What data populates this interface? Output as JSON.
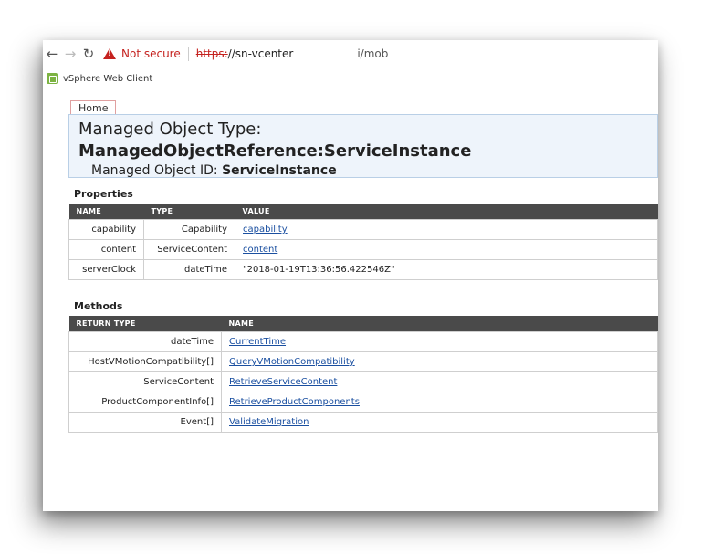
{
  "browser": {
    "security_text": "Not secure",
    "url_scheme": "https:",
    "url_host": "//sn-vcenter",
    "url_path": "i/mob",
    "bookmark": "vSphere Web Client"
  },
  "page": {
    "home_tab": "Home",
    "type_label": "Managed Object Type: ",
    "type_value": "ManagedObjectReference:ServiceInstance",
    "id_label": "Managed Object ID: ",
    "id_value": "ServiceInstance"
  },
  "properties": {
    "title": "Properties",
    "headers": [
      "NAME",
      "TYPE",
      "VALUE"
    ],
    "rows": [
      {
        "name": "capability",
        "type": "Capability",
        "value": "capability"
      },
      {
        "name": "content",
        "type": "ServiceContent",
        "value": "content"
      },
      {
        "name": "serverClock",
        "type": "dateTime",
        "value": "\"2018-01-19T13:36:56.422546Z\""
      }
    ]
  },
  "methods": {
    "title": "Methods",
    "headers": [
      "RETURN TYPE",
      "NAME"
    ],
    "rows": [
      {
        "return_type": "dateTime",
        "name": "CurrentTime"
      },
      {
        "return_type": "HostVMotionCompatibility[]",
        "name": "QueryVMotionCompatibility"
      },
      {
        "return_type": "ServiceContent",
        "name": "RetrieveServiceContent"
      },
      {
        "return_type": "ProductComponentInfo[]",
        "name": "RetrieveProductComponents"
      },
      {
        "return_type": "Event[]",
        "name": "ValidateMigration"
      }
    ]
  }
}
